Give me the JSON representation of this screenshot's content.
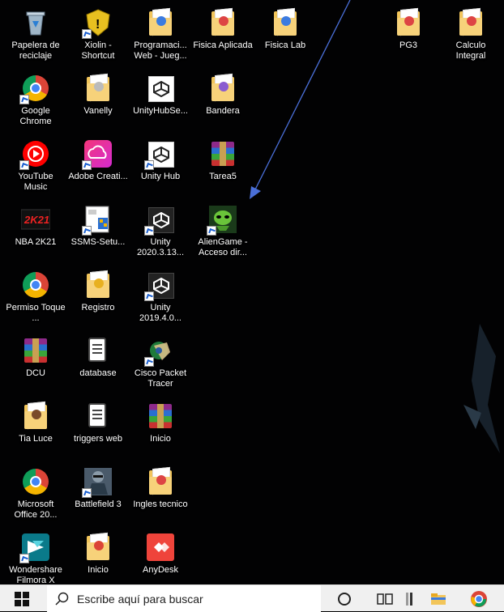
{
  "desktop": {
    "icons": [
      {
        "label": "Papelera de reciclaje"
      },
      {
        "label": "Xiolin - Shortcut"
      },
      {
        "label": "Programaci... Web - Jueg..."
      },
      {
        "label": "Fisica Aplicada"
      },
      {
        "label": "Fisica Lab"
      },
      {
        "label": "PG3"
      },
      {
        "label": "Calculo Integral"
      },
      {
        "label": "Google Chrome"
      },
      {
        "label": "Vanelly"
      },
      {
        "label": "UnityHubSe..."
      },
      {
        "label": "Bandera"
      },
      {
        "label": "YouTube Music"
      },
      {
        "label": "Adobe Creati..."
      },
      {
        "label": "Unity Hub"
      },
      {
        "label": "Tarea5"
      },
      {
        "label": "NBA 2K21"
      },
      {
        "label": "SSMS-Setu..."
      },
      {
        "label": "Unity 2020.3.13..."
      },
      {
        "label": "AlienGame - Acceso dir..."
      },
      {
        "label": "Permiso Toque ..."
      },
      {
        "label": "Registro"
      },
      {
        "label": "Unity 2019.4.0..."
      },
      {
        "label": "DCU"
      },
      {
        "label": "database"
      },
      {
        "label": "Cisco Packet Tracer"
      },
      {
        "label": "Tia Luce"
      },
      {
        "label": "triggers web"
      },
      {
        "label": "Inicio"
      },
      {
        "label": "Microsoft Office 20..."
      },
      {
        "label": "Battlefield 3"
      },
      {
        "label": "Ingles tecnico"
      },
      {
        "label": "Wondershare Filmora X"
      },
      {
        "label": "Inicio"
      },
      {
        "label": "AnyDesk"
      }
    ],
    "nba_logo_text": "2K21"
  },
  "taskbar": {
    "search_placeholder": "Escribe aquí para buscar"
  },
  "colors": {
    "annotation_arrow": "#4a6fd8",
    "taskbar_bg": "#f0f0f0"
  }
}
